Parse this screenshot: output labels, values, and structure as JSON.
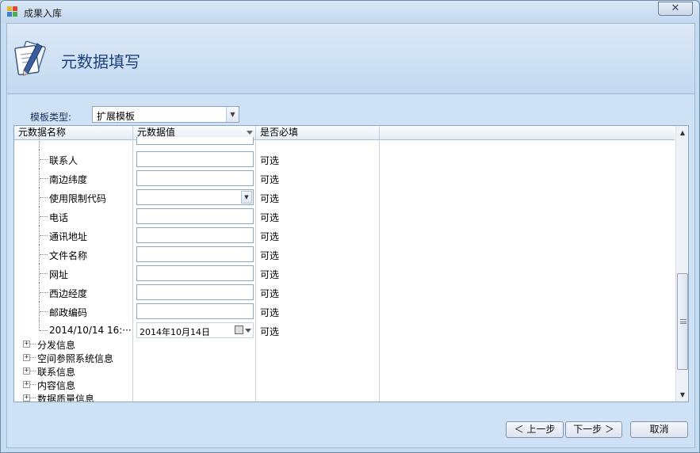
{
  "window": {
    "title": "成果入库",
    "close_glyph": "✕"
  },
  "header": {
    "title": "元数据填写",
    "icon": "document-pen-icon"
  },
  "template": {
    "label": "模板类型:",
    "value": "扩展模板"
  },
  "grid": {
    "columns": [
      "元数据名称",
      "元数据值",
      "是否必填"
    ],
    "rows": [
      {
        "name": "联系人",
        "value": "",
        "required": "可选",
        "type": "text"
      },
      {
        "name": "南边纬度",
        "value": "",
        "required": "可选",
        "type": "text"
      },
      {
        "name": "使用限制代码",
        "value": "",
        "required": "可选",
        "type": "dropdown"
      },
      {
        "name": "电话",
        "value": "",
        "required": "可选",
        "type": "text"
      },
      {
        "name": "通讯地址",
        "value": "",
        "required": "可选",
        "type": "text"
      },
      {
        "name": "文件名称",
        "value": "",
        "required": "可选",
        "type": "text"
      },
      {
        "name": "网址",
        "value": "",
        "required": "可选",
        "type": "text"
      },
      {
        "name": "西边经度",
        "value": "",
        "required": "可选",
        "type": "text"
      },
      {
        "name": "邮政编码",
        "value": "",
        "required": "可选",
        "type": "text"
      },
      {
        "name": "2014/10/14 16:···",
        "value": "2014年10月14日",
        "required": "可选",
        "type": "date"
      }
    ],
    "groups": [
      "分发信息",
      "空间参照系统信息",
      "联系信息",
      "内容信息",
      "数据质量信息"
    ]
  },
  "buttons": {
    "prev": "＜ 上一步",
    "next": "下一步 ＞",
    "cancel": "取消"
  }
}
